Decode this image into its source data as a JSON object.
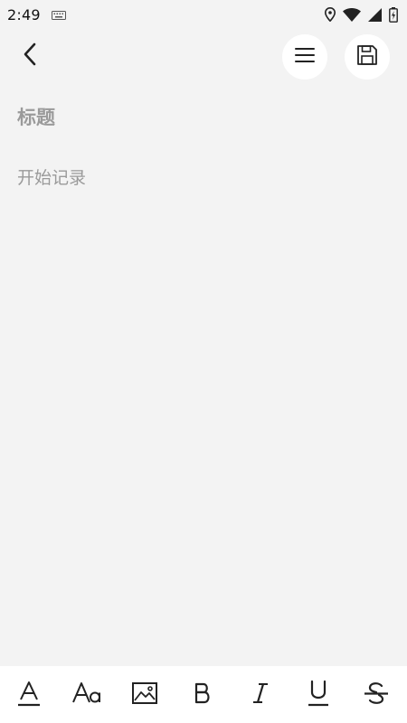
{
  "status_bar": {
    "time": "2:49",
    "icons": [
      "keyboard-icon",
      "location-icon",
      "wifi-icon",
      "signal-icon",
      "battery-icon"
    ]
  },
  "top_bar": {
    "back_icon": "chevron-left-icon",
    "menu_icon": "hamburger-menu-icon",
    "save_icon": "floppy-save-icon"
  },
  "editor": {
    "title_placeholder": "标题",
    "body_placeholder": "开始记录"
  },
  "toolbar": {
    "tools": [
      {
        "name": "text-color",
        "icon": "text-color-icon",
        "letter": "A"
      },
      {
        "name": "font-size",
        "icon": "font-size-icon",
        "letter": "Aa"
      },
      {
        "name": "insert-image",
        "icon": "image-icon"
      },
      {
        "name": "bold",
        "icon": "bold-icon",
        "letter": "B"
      },
      {
        "name": "italic",
        "icon": "italic-icon",
        "letter": "I"
      },
      {
        "name": "underline",
        "icon": "underline-icon",
        "letter": "U"
      },
      {
        "name": "strikethrough",
        "icon": "strikethrough-icon",
        "letter": "S"
      }
    ]
  },
  "colors": {
    "background": "#f3f3f3",
    "toolbar_background": "#ffffff",
    "placeholder_text": "#9a9a9a",
    "icon": "#222222"
  }
}
